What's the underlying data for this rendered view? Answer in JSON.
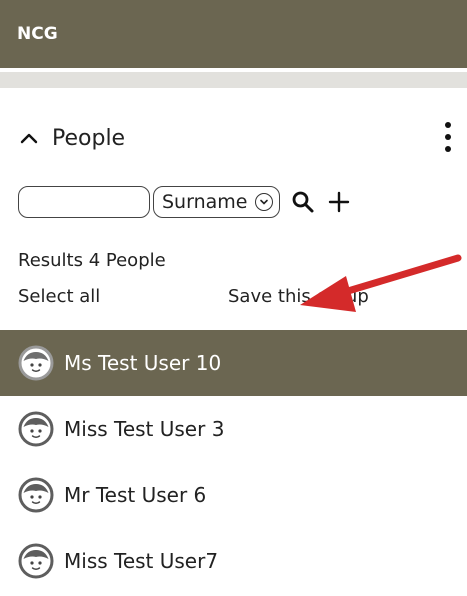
{
  "header": {
    "title": "NCG"
  },
  "section": {
    "title": "People"
  },
  "search": {
    "value": "",
    "placeholder": "",
    "sort_selected": "Surname"
  },
  "results_text": "Results 4 People",
  "select_all_label": "Select all",
  "save_group_label": "Save this group",
  "people": [
    {
      "name": "Ms Test User 10",
      "selected": true
    },
    {
      "name": "Miss Test User 3",
      "selected": false
    },
    {
      "name": "Mr Test User 6",
      "selected": false
    },
    {
      "name": "Miss Test User7",
      "selected": false
    }
  ],
  "icons": {
    "collapse": "chevron-up-icon",
    "menu": "kebab-menu-icon",
    "search": "search-icon",
    "add": "plus-icon",
    "avatar": "user-avatar-icon",
    "annotation": "red-arrow"
  },
  "colors": {
    "header_bg": "#6b6651",
    "selected_row_bg": "#6b6651",
    "strip": "#e2e1dd",
    "annotation_arrow": "#d42a2a"
  }
}
